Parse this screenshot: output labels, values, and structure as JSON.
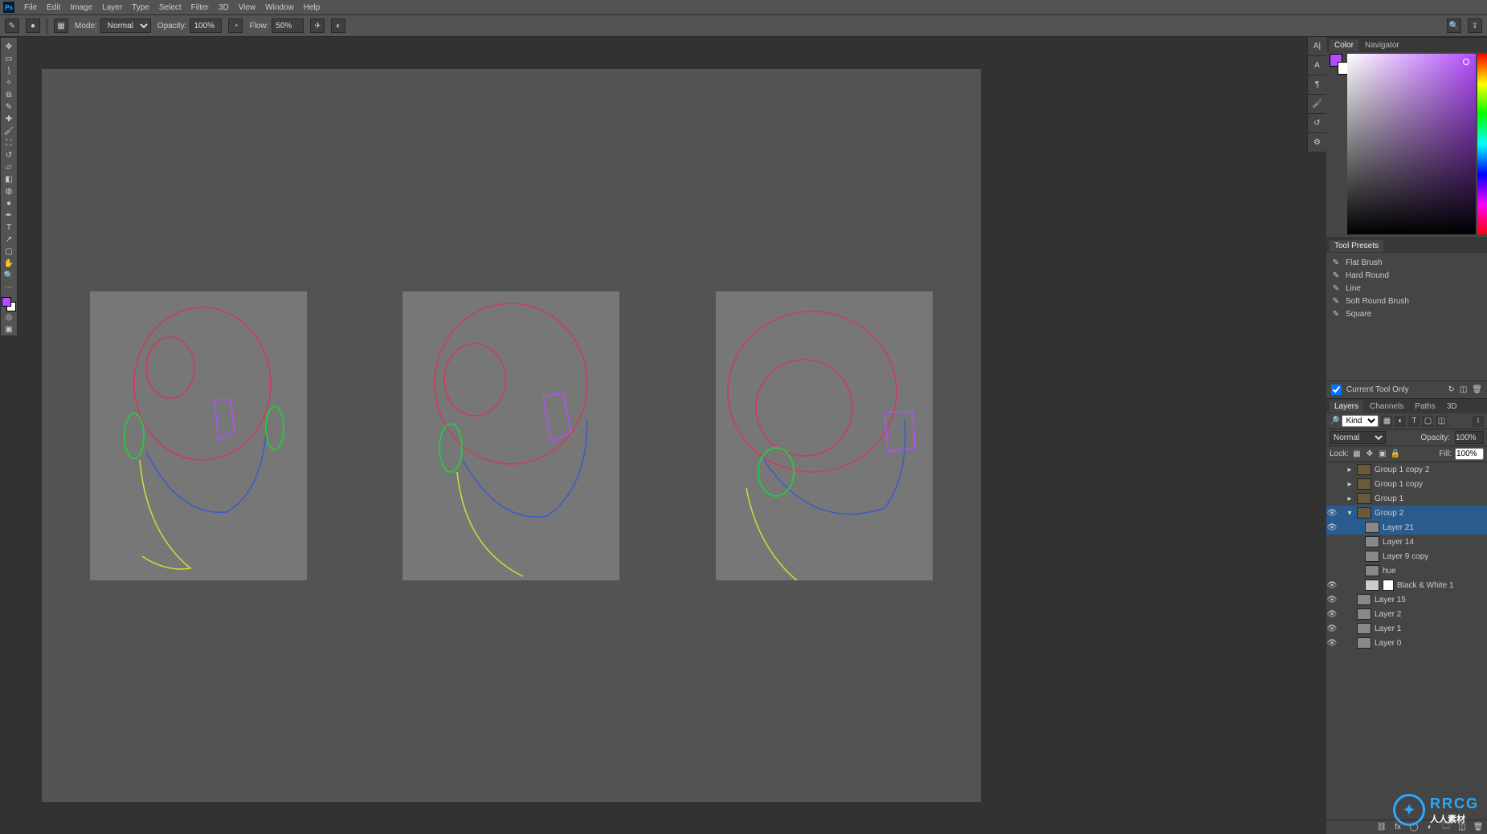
{
  "menubar": {
    "items": [
      "File",
      "Edit",
      "Image",
      "Layer",
      "Type",
      "Select",
      "Filter",
      "3D",
      "View",
      "Window",
      "Help"
    ]
  },
  "optionsbar": {
    "mode_label": "Mode:",
    "mode_value": "Normal",
    "opacity_label": "Opacity:",
    "opacity_value": "100%",
    "flow_label": "Flow:",
    "flow_value": "50%"
  },
  "collapsed_panels": {
    "label": "A|"
  },
  "color_panel": {
    "tabs": [
      "Color",
      "Navigator"
    ]
  },
  "presets_panel": {
    "title": "Tool Presets",
    "items": [
      "Flat Brush",
      "Hard Round",
      "Line",
      "Soft Round Brush",
      "Square"
    ],
    "current_tool": "Current Tool Only"
  },
  "layers_panel": {
    "tabs": [
      "Layers",
      "Channels",
      "Paths",
      "3D"
    ],
    "filter_label": "Kind",
    "blend_mode": "Normal",
    "opacity_label": "Opacity:",
    "opacity_value": "100%",
    "lock_label": "Lock:",
    "fill_label": "Fill:",
    "fill_value": "100%",
    "layers": [
      {
        "vis": false,
        "indent": 1,
        "folder": true,
        "name": "Group 1 copy 2"
      },
      {
        "vis": false,
        "indent": 1,
        "folder": true,
        "name": "Group 1 copy"
      },
      {
        "vis": false,
        "indent": 1,
        "folder": true,
        "name": "Group 1"
      },
      {
        "vis": true,
        "indent": 1,
        "folder": true,
        "open": true,
        "selected": true,
        "name": "Group 2"
      },
      {
        "vis": true,
        "indent": 2,
        "folder": false,
        "selected": true,
        "name": "Layer 21"
      },
      {
        "vis": false,
        "indent": 2,
        "folder": false,
        "name": "Layer 14"
      },
      {
        "vis": false,
        "indent": 2,
        "folder": false,
        "name": "Layer 9 copy"
      },
      {
        "vis": false,
        "indent": 2,
        "folder": false,
        "name": "hue"
      },
      {
        "vis": true,
        "indent": 2,
        "folder": false,
        "adj": true,
        "mask": true,
        "name": "Black & White 1"
      },
      {
        "vis": true,
        "indent": 1,
        "folder": false,
        "name": "Layer 15"
      },
      {
        "vis": true,
        "indent": 1,
        "folder": false,
        "name": "Layer 2"
      },
      {
        "vis": true,
        "indent": 1,
        "folder": false,
        "name": "Layer 1"
      },
      {
        "vis": true,
        "indent": 1,
        "folder": false,
        "name": "Layer 0"
      }
    ]
  },
  "watermark": {
    "brand": "RRCG",
    "sub": "人人素材"
  }
}
